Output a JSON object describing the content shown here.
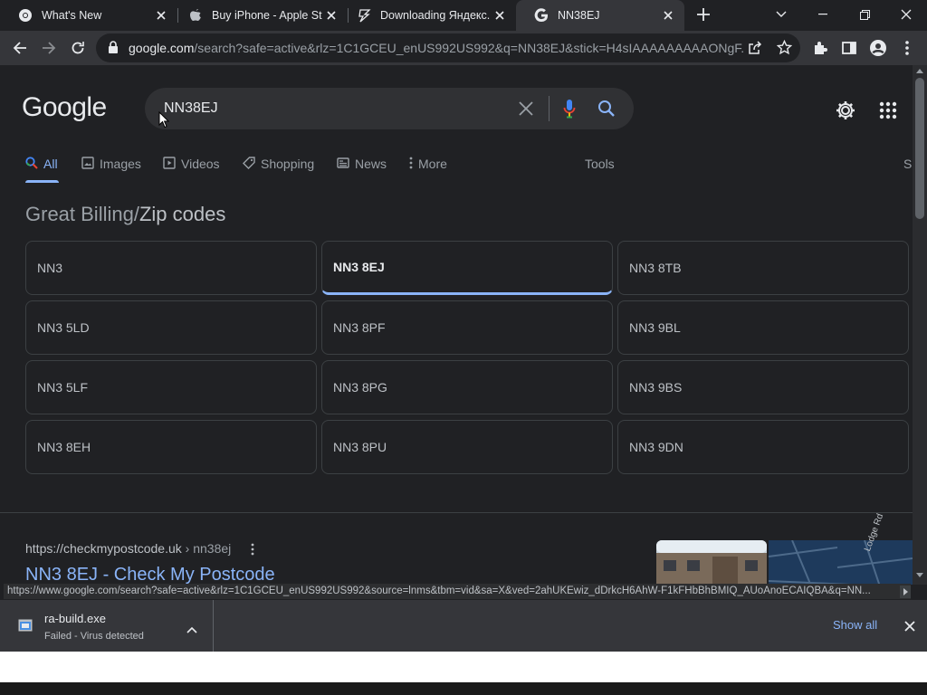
{
  "tabs": [
    {
      "title": "What's New",
      "icon": "chrome-icon"
    },
    {
      "title": "Buy iPhone - Apple Sto",
      "icon": "apple-icon"
    },
    {
      "title": "Downloading Яндекс.E",
      "icon": "lightning-icon"
    },
    {
      "title": "NN38EJ",
      "icon": "google-icon"
    }
  ],
  "omnibox": {
    "domain": "google.com",
    "path": "/search?safe=active&rlz=1C1GCEU_enUS992US992&q=NN38EJ&stick=H4sIAAAAAAAAAONgF..."
  },
  "google": {
    "logo": "Google",
    "query": "NN38EJ",
    "nav": {
      "all": "All",
      "images": "Images",
      "videos": "Videos",
      "shopping": "Shopping",
      "news": "News",
      "more": "More",
      "tools": "Tools",
      "overflow": "S"
    },
    "heading_parent": "Great Billing",
    "heading_sep": "/",
    "heading_current": "Zip codes",
    "zipcodes": [
      "NN3",
      "NN3 8EJ",
      "NN3 8TB",
      "NN3 5LD",
      "NN3 8PF",
      "NN3 9BL",
      "NN3 5LF",
      "NN3 8PG",
      "NN3 9BS",
      "NN3 8EH",
      "NN3 8PU",
      "NN3 9DN"
    ],
    "selected_zip": "NN3 8EJ",
    "result": {
      "cite_domain": "https://checkmypostcode.uk",
      "cite_path": " › nn38ej",
      "title": "NN3 8EJ - Check My Postcode"
    },
    "map_label": "Lodge Rd"
  },
  "status_url": "https://www.google.com/search?safe=active&rlz=1C1GCEU_enUS992US992&source=lnms&tbm=vid&sa=X&ved=2ahUKEwiz_dDrkcH6AhW-F1kFHbBhBMIQ_AUoAnoECAIQBA&q=NN...",
  "download": {
    "filename": "ra-build.exe",
    "status": "Failed - Virus detected",
    "show_all": "Show all"
  },
  "colors": {
    "accent": "#8ab4f8",
    "background": "#202124",
    "toolbar": "#35363a"
  }
}
